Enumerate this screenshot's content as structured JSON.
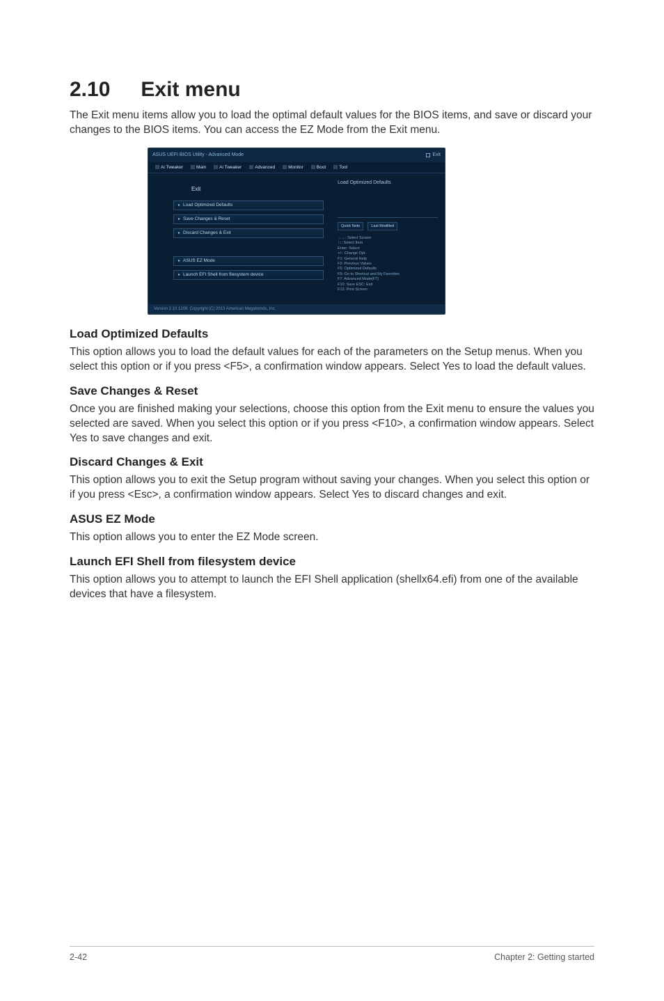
{
  "title_num": "2.10",
  "title_text": "Exit menu",
  "intro": "The Exit menu items allow you to load the optimal default values for the BIOS items, and save or discard your changes to the BIOS items. You can access the EZ Mode from the Exit menu.",
  "bios": {
    "topbar_left": "ASUS UEFI BIOS Utility - Advanced Mode",
    "topbar_right_exit": "Exit",
    "tabs": [
      "Ai Tweaker",
      "Main",
      "Ai Tweaker",
      "Advanced",
      "Monitor",
      "Boot",
      "Tool"
    ],
    "exit_label": "Exit",
    "menu_items_group1": [
      "Load Optimized Defaults",
      "Save Changes & Reset",
      "Discard Changes & Exit"
    ],
    "menu_items_group2": [
      "ASUS EZ Mode",
      "Launch EFI Shell from filesystem device"
    ],
    "right_hint_top": "Load Optimized Defaults",
    "quick_note": "Quick Note",
    "last_modified": "Last Modified",
    "help_text": "→←: Select Screen\n↑↓: Select Item\nEnter: Select\n+/-: Change Opt.\nF1: General Help\nF2: Previous Values\nF5: Optimized Defaults\nF9: Go to Shortcut and My Favorites\nF7: Advanced Mode(F7)\nF10: Save ESC: Exit\nF12: Print Screen",
    "bottom_bar": "Version 2.10.1208. Copyright (C) 2013 American Megatrends, Inc."
  },
  "sections": [
    {
      "heading": "Load Optimized Defaults",
      "body": "This option allows you to load the default values for each of the parameters on the Setup menus. When you select this option or if you press <F5>, a confirmation window appears. Select Yes to load the default values."
    },
    {
      "heading": "Save Changes & Reset",
      "body": "Once you are finished making your selections, choose this option from the Exit menu to ensure the values you selected are saved. When you select this option or if you press <F10>, a confirmation window appears. Select Yes to save changes and exit."
    },
    {
      "heading": "Discard Changes & Exit",
      "body": "This option allows you to exit the Setup program without saving your changes. When you select this option or if you press <Esc>, a confirmation window appears. Select Yes to discard changes and exit."
    },
    {
      "heading": "ASUS EZ Mode",
      "body": "This option allows you to enter the EZ Mode screen."
    },
    {
      "heading": "Launch EFI Shell from filesystem device",
      "body": "This option allows you to attempt to launch the EFI Shell application (shellx64.efi) from one of the available devices that have a filesystem."
    }
  ],
  "footer_left": "2-42",
  "footer_right": "Chapter 2: Getting started"
}
